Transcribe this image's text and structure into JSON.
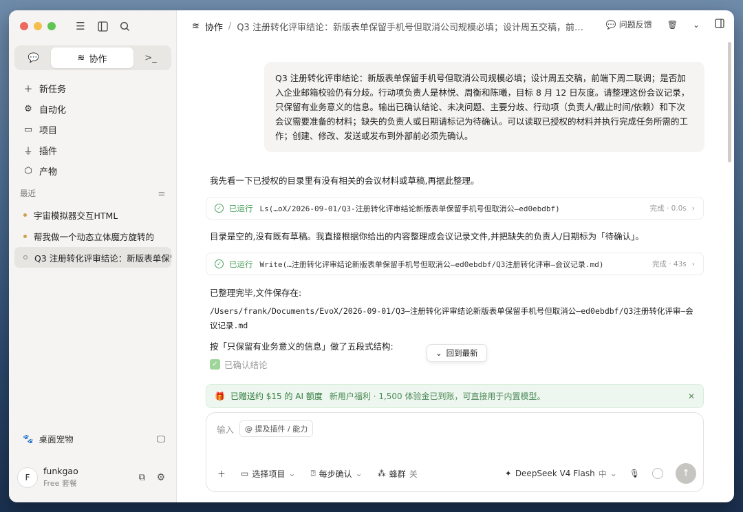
{
  "sidebar": {
    "tabs": {
      "collab": "协作"
    },
    "nav": [
      {
        "label": "新任务",
        "icon": "plus-icon"
      },
      {
        "label": "自动化",
        "icon": "automation-icon"
      },
      {
        "label": "项目",
        "icon": "folder-icon"
      },
      {
        "label": "插件",
        "icon": "plug-icon"
      },
      {
        "label": "产物",
        "icon": "cube-icon"
      }
    ],
    "recent_label": "最近",
    "recent": [
      "宇宙模拟器交互HTML",
      "帮我做一个动态立体魔方旋转的",
      "Q3 注册转化评审结论：新版表单保留手机号但取消公司规模必填"
    ],
    "pet": "桌面宠物",
    "user": {
      "initial": "F",
      "name": "funkgao",
      "plan": "Free 套餐"
    }
  },
  "header": {
    "crumb_root": "协作",
    "crumb_sep": "/",
    "crumb_current": "Q3 注册转化评审结论：新版表单保留手机号但取消公司规模必填；设计周五交稿，前端...",
    "feedback": "问题反馈"
  },
  "conversation": {
    "user_message": "Q3 注册转化评审结论：新版表单保留手机号但取消公司规模必填；设计周五交稿，前端下周二联调；是否加入企业邮箱校验仍有分歧。行动项负责人是林悦、周衡和陈曦，目标 8 月 12 日灰度。请整理这份会议记录，只保留有业务意义的信息。输出已确认结论、未决问题、主要分歧、行动项（负责人/截止时间/依赖）和下次会议需要准备的材料；缺失的负责人或日期请标记为待确认。可以读取已授权的材料并执行完成任务所需的工作；创建、修改、发送或发布到外部前必须先确认。",
    "reply_1": "我先看一下已授权的目录里有没有相关的会议材料或草稿,再据此整理。",
    "tool_1": {
      "status": "已运行",
      "cmd": "Ls(…oX/2026-09-01/Q3-注册转化评审结论新版表单保留手机号但取消公—ed0ebdbf)",
      "meta": "完成 · 0.0s"
    },
    "reply_2": "目录是空的,没有既有草稿。我直接根据你给出的内容整理成会议记录文件,并把缺失的负责人/日期标为「待确认」。",
    "tool_2": {
      "status": "已运行",
      "cmd": "Write(…注册转化评审结论新版表单保留手机号但取消公—ed0ebdbf/Q3注册转化评审—会议记录.md)",
      "meta": "完成 · 43s"
    },
    "reply_3": "已整理完毕,文件保存在:",
    "path": "/Users/frank/Documents/EvoX/2026-09-01/Q3—注册转化评审结论新版表单保留手机号但取消公—ed0ebdbf/Q3注册转化评审—会议记录.md",
    "reply_4": "按「只保留有业务意义的信息」做了五段式结构:",
    "confirmed": "已确认结论",
    "jump_latest": "回到最新"
  },
  "banner": {
    "title": "已赠送约 $15 的 AI 额度",
    "subtitle": "新用户福利 · 1,500 体验金已到账，可直接用于内置模型。"
  },
  "composer": {
    "placeholder": "输入",
    "chip": "@ 提及插件 / 能力",
    "select_project": "选择项目",
    "confirm_mode": "每步确认",
    "swarm": "蜂群",
    "swarm_state": "关",
    "model": "DeepSeek V4 Flash",
    "effort": "中"
  },
  "colors": {
    "accent_green": "#4a9e5c",
    "banner_bg": "#eef7ef"
  }
}
